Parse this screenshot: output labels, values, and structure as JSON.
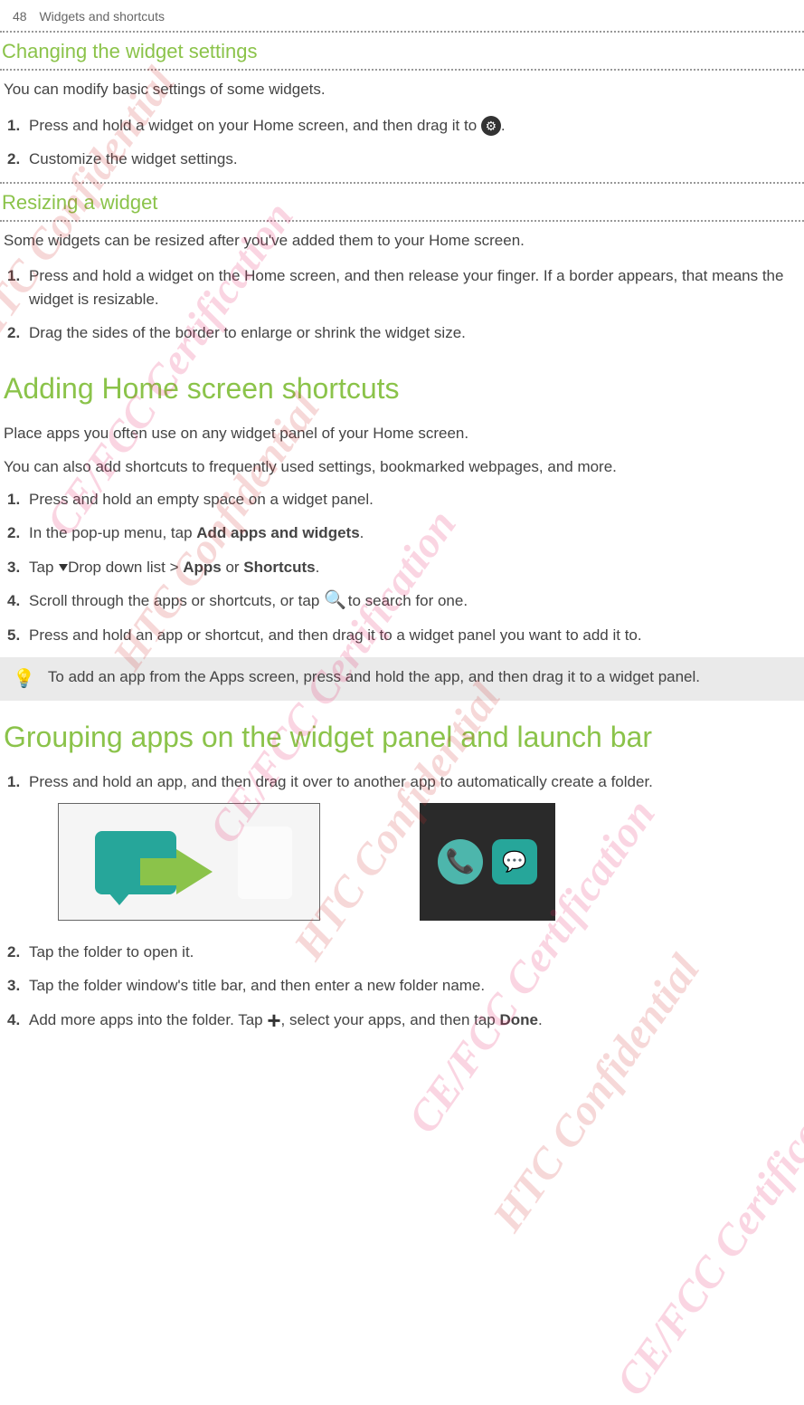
{
  "header": {
    "page": "48",
    "section": "Widgets and shortcuts"
  },
  "changeSettings": {
    "heading": "Changing the widget settings",
    "intro": "You can modify basic settings of some widgets.",
    "steps": [
      {
        "num": "1.",
        "textBefore": "Press and hold a widget on your Home screen, and then drag it to ",
        "textAfter": "."
      },
      {
        "num": "2.",
        "text": "Customize the widget settings."
      }
    ]
  },
  "resizing": {
    "heading": "Resizing a widget",
    "intro": "Some widgets can be resized after you've added them to your Home screen.",
    "steps": [
      {
        "num": "1.",
        "text": "Press and hold a widget on the Home screen, and then release your finger. If a border appears, that means the widget is resizable."
      },
      {
        "num": "2.",
        "text": "Drag the sides of the border to enlarge or shrink the widget size."
      }
    ]
  },
  "adding": {
    "heading": "Adding Home screen shortcuts",
    "intro1": "Place apps you often use on any widget panel of your Home screen.",
    "intro2": " You can also add shortcuts to frequently used settings, bookmarked webpages, and more.",
    "steps": {
      "s1": {
        "num": "1.",
        "text": "Press and hold an empty space on a widget panel."
      },
      "s2": {
        "num": "2.",
        "before": "In the pop-up menu, tap ",
        "bold": "Add apps and widgets",
        "after": "."
      },
      "s3": {
        "num": "3.",
        "before": "Tap ",
        "mid": "Drop down list > ",
        "bold1": "Apps",
        "or": " or ",
        "bold2": "Shortcuts",
        "after": "."
      },
      "s4": {
        "num": "4.",
        "before": "Scroll through the apps or shortcuts, or tap ",
        "after": " to search for one."
      },
      "s5": {
        "num": "5.",
        "text": "Press and hold an app or shortcut, and then drag it to a widget panel you want to add it to."
      }
    },
    "tip": "To add an app from the Apps screen, press and hold the app, and then drag it to a widget panel."
  },
  "grouping": {
    "heading": "Grouping apps on the widget panel and launch bar",
    "steps": {
      "s1": {
        "num": "1.",
        "text": "Press and hold an app, and then drag it over to another app to automatically create a folder."
      },
      "s2": {
        "num": "2.",
        "text": "Tap the folder to open it."
      },
      "s3": {
        "num": "3.",
        "text": "Tap the folder window's title bar, and then enter a new folder name."
      },
      "s4": {
        "num": "4.",
        "before": "Add more apps into the folder. Tap ",
        "after": ", select your apps, and then tap ",
        "bold": "Done",
        "end": "."
      }
    }
  },
  "icons": {
    "settings": "⚙",
    "search": "🔍",
    "plus": "+"
  },
  "watermarks": {
    "htc": "HTC Confidential",
    "cefcc": "CE/FCC Certification"
  }
}
